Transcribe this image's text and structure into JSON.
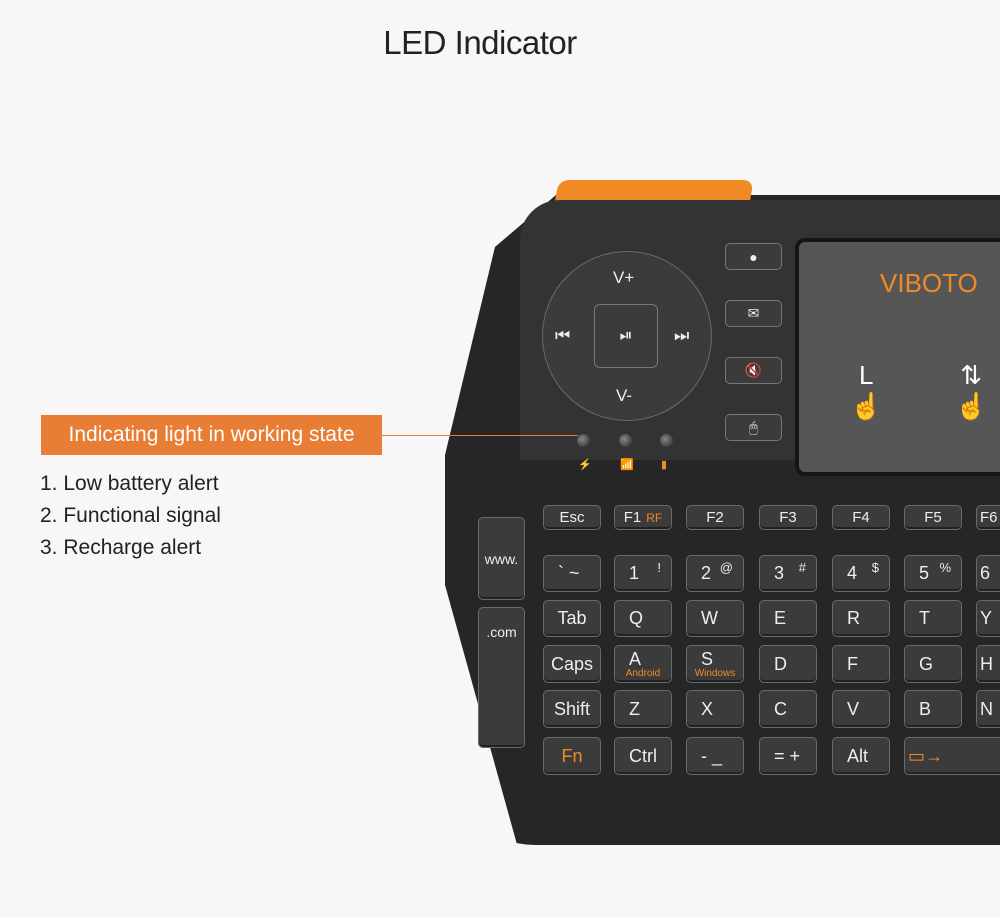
{
  "title": "LED Indicator",
  "callout": {
    "label": "Indicating light in working state",
    "items": [
      "1. Low battery alert",
      "2. Functional signal",
      "3. Recharge alert"
    ]
  },
  "accent": "#e87d35",
  "keyboard": {
    "brand": "VIBOTO",
    "dpad": {
      "up": "V+",
      "down": "V-",
      "left": "⏮",
      "right": "⏭",
      "center": "⏯"
    },
    "side_buttons": [
      {
        "icon": "play-icon",
        "glyph": "●"
      },
      {
        "icon": "mail-icon",
        "glyph": "✉"
      },
      {
        "icon": "mute-icon",
        "glyph": "🔇"
      },
      {
        "icon": "mouse-icon",
        "glyph": "🖱"
      }
    ],
    "leds": [
      {
        "icon": "battery-icon",
        "glyph": "⚡"
      },
      {
        "icon": "signal-icon",
        "glyph": "📶"
      },
      {
        "icon": "charge-icon",
        "glyph": "▮"
      }
    ],
    "gestures": [
      {
        "label": "L",
        "icon": "tap-icon",
        "glyph": "☝"
      },
      {
        "label": "⇅",
        "icon": "scroll-icon",
        "glyph": "☝"
      }
    ],
    "side_keys": [
      "www.",
      ".com"
    ],
    "rows": [
      [
        {
          "m": "Esc"
        },
        {
          "m": "F1",
          "o": "RF"
        },
        {
          "m": "F2"
        },
        {
          "m": "F3"
        },
        {
          "m": "F4"
        },
        {
          "m": "F5"
        },
        {
          "m": "F6"
        }
      ],
      [
        {
          "m": "` ~"
        },
        {
          "m": "1",
          "s": "!"
        },
        {
          "m": "2",
          "s": "@"
        },
        {
          "m": "3",
          "s": "#"
        },
        {
          "m": "4",
          "s": "$"
        },
        {
          "m": "5",
          "s": "%"
        },
        {
          "m": "6"
        }
      ],
      [
        {
          "m": "Tab"
        },
        {
          "m": "Q"
        },
        {
          "m": "W"
        },
        {
          "m": "E"
        },
        {
          "m": "R"
        },
        {
          "m": "T"
        },
        {
          "m": "Y"
        }
      ],
      [
        {
          "m": "Caps"
        },
        {
          "m": "A",
          "b": "Android"
        },
        {
          "m": "S",
          "b": "Windows"
        },
        {
          "m": "D"
        },
        {
          "m": "F"
        },
        {
          "m": "G"
        },
        {
          "m": "H"
        }
      ],
      [
        {
          "m": "Shift"
        },
        {
          "m": "Z"
        },
        {
          "m": "X"
        },
        {
          "m": "C"
        },
        {
          "m": "V"
        },
        {
          "m": "B"
        },
        {
          "m": "N"
        }
      ],
      [
        {
          "m": "Fn"
        },
        {
          "m": "Ctrl"
        },
        {
          "m": "- _"
        },
        {
          "m": "= +"
        },
        {
          "m": "Alt"
        },
        {
          "m": "▭→"
        }
      ]
    ]
  }
}
